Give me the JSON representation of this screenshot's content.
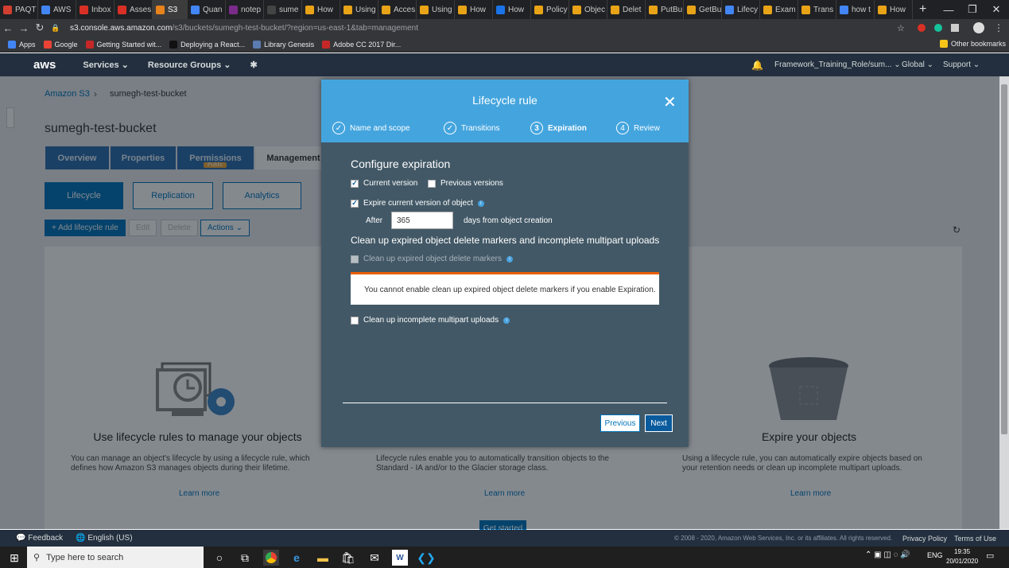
{
  "browser": {
    "tabs": [
      {
        "label": "PAQT",
        "color": "#d23f31"
      },
      {
        "label": "AWS",
        "color": "#4285f4"
      },
      {
        "label": "Inbox",
        "color": "#d93025"
      },
      {
        "label": "Asses",
        "color": "#d93025"
      },
      {
        "label": "S3",
        "color": "#e8821c",
        "active": true
      },
      {
        "label": "Quan",
        "color": "#4285f4"
      },
      {
        "label": "notep",
        "color": "#7b2c8b"
      },
      {
        "label": "sume",
        "color": "#444"
      },
      {
        "label": "How",
        "color": "#e8a317"
      },
      {
        "label": "Using",
        "color": "#e8a317"
      },
      {
        "label": "Acces",
        "color": "#e8a317"
      },
      {
        "label": "Using",
        "color": "#e8a317"
      },
      {
        "label": "How",
        "color": "#e8a317"
      },
      {
        "label": "How",
        "color": "#1a73e8"
      },
      {
        "label": "Policy",
        "color": "#e8a317"
      },
      {
        "label": "Objec",
        "color": "#e8a317"
      },
      {
        "label": "Delet",
        "color": "#e8a317"
      },
      {
        "label": "PutBu",
        "color": "#e8a317"
      },
      {
        "label": "GetBu",
        "color": "#e8a317"
      },
      {
        "label": "Lifecy",
        "color": "#4285f4"
      },
      {
        "label": "Exam",
        "color": "#e8a317"
      },
      {
        "label": "Trans",
        "color": "#e8a317"
      },
      {
        "label": "how t",
        "color": "#4285f4"
      },
      {
        "label": "How",
        "color": "#e8a317"
      }
    ],
    "new_tab": "+",
    "url_host": "s3.console.aws.amazon.com",
    "url_path": "/s3/buckets/sumegh-test-bucket/?region=us-east-1&tab=management",
    "bookmarks": [
      {
        "label": "Apps",
        "color": "#4285f4"
      },
      {
        "label": "Google",
        "color": "#ea4335"
      },
      {
        "label": "Getting Started wit...",
        "color": "#c62828"
      },
      {
        "label": "Deploying a React...",
        "color": "#111"
      },
      {
        "label": "Library Genesis",
        "color": "#5b7bb1"
      },
      {
        "label": "Adobe CC 2017 Dir...",
        "color": "#c62828"
      }
    ],
    "other_bookmarks": "Other bookmarks"
  },
  "aws_nav": {
    "logo": "aws",
    "services": "Services",
    "resource_groups": "Resource Groups",
    "role": "Framework_Training_Role/sum...",
    "region": "Global",
    "support": "Support"
  },
  "page": {
    "breadcrumb_root": "Amazon S3",
    "breadcrumb_sep": "›",
    "breadcrumb_bucket": "sumegh-test-bucket",
    "bucket_title": "sumegh-test-bucket",
    "tabs": [
      "Overview",
      "Properties",
      "Permissions",
      "Management"
    ],
    "permissions_badge": "Public",
    "sub_tabs": [
      "Lifecycle",
      "Replication",
      "Analytics"
    ],
    "add_rule": "+ Add lifecycle rule",
    "edit": "Edit",
    "delete": "Delete",
    "actions": "Actions",
    "columns": [
      {
        "heading": "Use lifecycle rules to manage your objects",
        "text": "You can manage an object's lifecycle by using a lifecycle rule, which defines how Amazon S3 manages objects during their lifetime.",
        "link": "Learn more"
      },
      {
        "heading": "",
        "text": "Lifecycle rules enable you to automatically transition objects to the Standard - IA and/or to the Glacier storage class.",
        "link": "Learn more"
      },
      {
        "heading": "Expire your objects",
        "text": "Using a lifecycle rule, you can automatically expire objects based on your retention needs or clean up incomplete multipart uploads.",
        "link": "Learn more"
      }
    ],
    "get_started": "Get started"
  },
  "modal": {
    "title": "Lifecycle rule",
    "steps": [
      {
        "label": "Name and scope",
        "marker": "✓"
      },
      {
        "label": "Transitions",
        "marker": "✓"
      },
      {
        "label": "Expiration",
        "marker": "3"
      },
      {
        "label": "Review",
        "marker": "4"
      }
    ],
    "section_title": "Configure expiration",
    "current_version": "Current version",
    "previous_versions": "Previous versions",
    "expire_current": "Expire current version of object",
    "after_label": "After",
    "after_value": "365",
    "after_suffix": "days from object creation",
    "cleanup_title": "Clean up expired object delete markers and incomplete multipart uploads",
    "cleanup_markers": "Clean up expired object delete markers",
    "warning": "You cannot enable clean up expired object delete markers if you enable Expiration.",
    "cleanup_multipart": "Clean up incomplete multipart uploads",
    "previous_btn": "Previous",
    "next_btn": "Next"
  },
  "footer": {
    "feedback": "Feedback",
    "language": "English (US)",
    "copyright": "© 2008 - 2020, Amazon Web Services, Inc. or its affiliates. All rights reserved.",
    "privacy": "Privacy Policy",
    "terms": "Terms of Use"
  },
  "taskbar": {
    "search_placeholder": "Type here to search",
    "lang": "ENG",
    "time": "19:35",
    "date": "20/01/2020"
  }
}
